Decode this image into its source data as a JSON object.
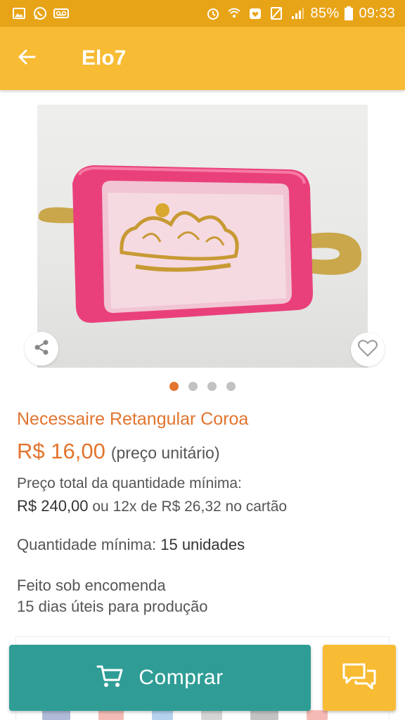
{
  "status_bar": {
    "battery": "85%",
    "time": "09:33",
    "left_icons": [
      "image-icon",
      "whatsapp-icon",
      "voicemail-icon"
    ],
    "right_icons": [
      "alarm-icon",
      "wifi-icon",
      "heart-icon",
      "no-sim-icon",
      "signal-icon",
      "battery-icon"
    ]
  },
  "app_bar": {
    "title": "Elo7",
    "back_icon": "arrow-left-icon"
  },
  "product": {
    "image_alt": "pink-cosmetic-bag-with-gold-crown",
    "name": "Necessaire Retangular Coroa",
    "price": "R$ 16,00",
    "price_unit": "(preço unitário)",
    "total_label": "Preço total da quantidade mínima:",
    "total_price": "R$ 240,00",
    "installments": "ou 12x de R$ 26,32 no cartão",
    "min_qty_label": "Quantidade mínima:",
    "min_qty_value": "15 unidades",
    "made_to_order": "Feito sob encomenda",
    "production_time": "15 dias úteis para produção"
  },
  "carousel": {
    "total": 4,
    "active": 1
  },
  "actions": {
    "buy_label": "Comprar",
    "buy_icon": "cart-icon",
    "chat_icon": "chat-bubbles-icon",
    "share_icon": "share-icon",
    "favorite_icon": "heart-outline-icon"
  },
  "colors": {
    "status_bar": "#e8a417",
    "app_bar": "#f8bb34",
    "accent_orange": "#e2742e",
    "buy_button": "#2f9d96",
    "chat_button": "#f8bb34"
  }
}
